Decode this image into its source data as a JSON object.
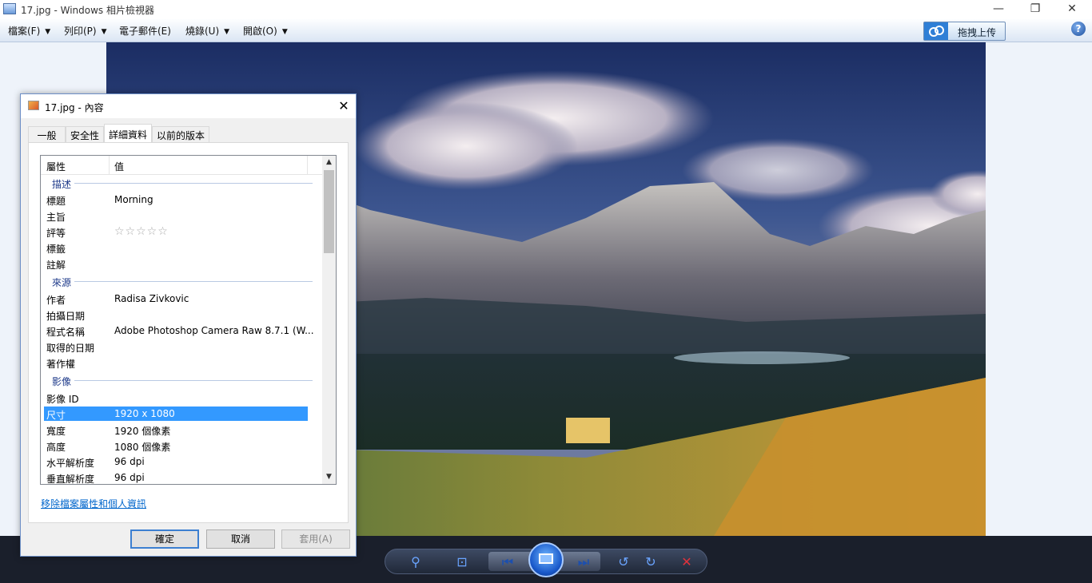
{
  "window": {
    "title": "17.jpg - Windows 相片檢視器",
    "controls": {
      "minimize": "—",
      "restore": "❐",
      "close": "✕"
    }
  },
  "menu": {
    "items": [
      {
        "label": "檔案(F)",
        "caret": "▼"
      },
      {
        "label": "列印(P)",
        "caret": "▼"
      },
      {
        "label": "電子郵件(E)",
        "caret": ""
      },
      {
        "label": "燒錄(U)",
        "caret": "▼"
      },
      {
        "label": "開啟(O)",
        "caret": "▼"
      }
    ],
    "upload_label": "拖拽上传",
    "help": "?"
  },
  "dialog": {
    "title": "17.jpg - 內容",
    "close": "✕",
    "tabs": [
      "一般",
      "安全性",
      "詳細資料",
      "以前的版本"
    ],
    "active_tab": "詳細資料",
    "columns": {
      "property": "屬性",
      "value": "值"
    },
    "groups": {
      "description": "描述",
      "origin": "來源",
      "image": "影像"
    },
    "description_rows": [
      {
        "key": "標題",
        "value": "Morning"
      },
      {
        "key": "主旨",
        "value": ""
      },
      {
        "key": "評等",
        "value": "☆☆☆☆☆"
      },
      {
        "key": "標籤",
        "value": ""
      },
      {
        "key": "註解",
        "value": ""
      }
    ],
    "origin_rows": [
      {
        "key": "作者",
        "value": "Radisa Zivkovic"
      },
      {
        "key": "拍攝日期",
        "value": ""
      },
      {
        "key": "程式名稱",
        "value": "Adobe Photoshop Camera Raw 8.7.1 (W..."
      },
      {
        "key": "取得的日期",
        "value": ""
      },
      {
        "key": "著作權",
        "value": ""
      }
    ],
    "image_rows": [
      {
        "key": "影像 ID",
        "value": ""
      },
      {
        "key": "尺寸",
        "value": "1920 x 1080",
        "selected": true
      },
      {
        "key": "寬度",
        "value": "1920 個像素"
      },
      {
        "key": "高度",
        "value": "1080 個像素"
      },
      {
        "key": "水平解析度",
        "value": "96 dpi"
      },
      {
        "key": "垂直解析度",
        "value": "96 dpi"
      }
    ],
    "remove_link": "移除檔案屬性和個人資訊",
    "buttons": {
      "ok": "確定",
      "cancel": "取消",
      "apply": "套用(A)"
    }
  },
  "toolbar": {
    "zoom": "⚲",
    "fit": "⊡",
    "prev": "⏮",
    "next": "⏭",
    "rotate_ccw": "↺",
    "rotate_cw": "↻",
    "delete": "✕"
  },
  "colors": {
    "selection": "#3399ff",
    "link": "#0066cc",
    "toolbar_bg": "#1a1f2b",
    "delete_red": "#e0323c"
  }
}
